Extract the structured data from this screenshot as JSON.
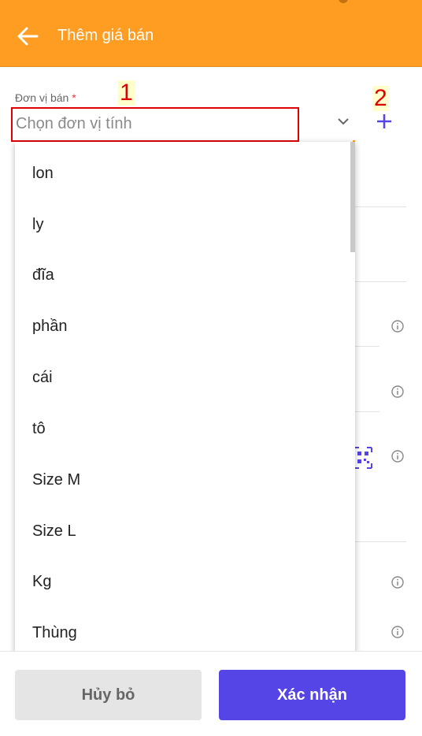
{
  "header": {
    "title": "Thêm giá bán"
  },
  "field": {
    "label": "Đơn vị bán",
    "required_mark": "*",
    "placeholder": "Chọn đơn vị tính"
  },
  "badges": {
    "one": "1",
    "two": "2"
  },
  "dropdown": {
    "options": [
      "lon",
      "ly",
      "đĩa",
      "phần",
      "cái",
      "tô",
      "Size M",
      "Size L",
      "Kg",
      "Thùng"
    ]
  },
  "actions": {
    "cancel_label": "Hủy bỏ",
    "confirm_label": "Xác nhận"
  },
  "colors": {
    "accent": "#ff9c22",
    "primary": "#5544e6",
    "highlight": "#e00000"
  }
}
